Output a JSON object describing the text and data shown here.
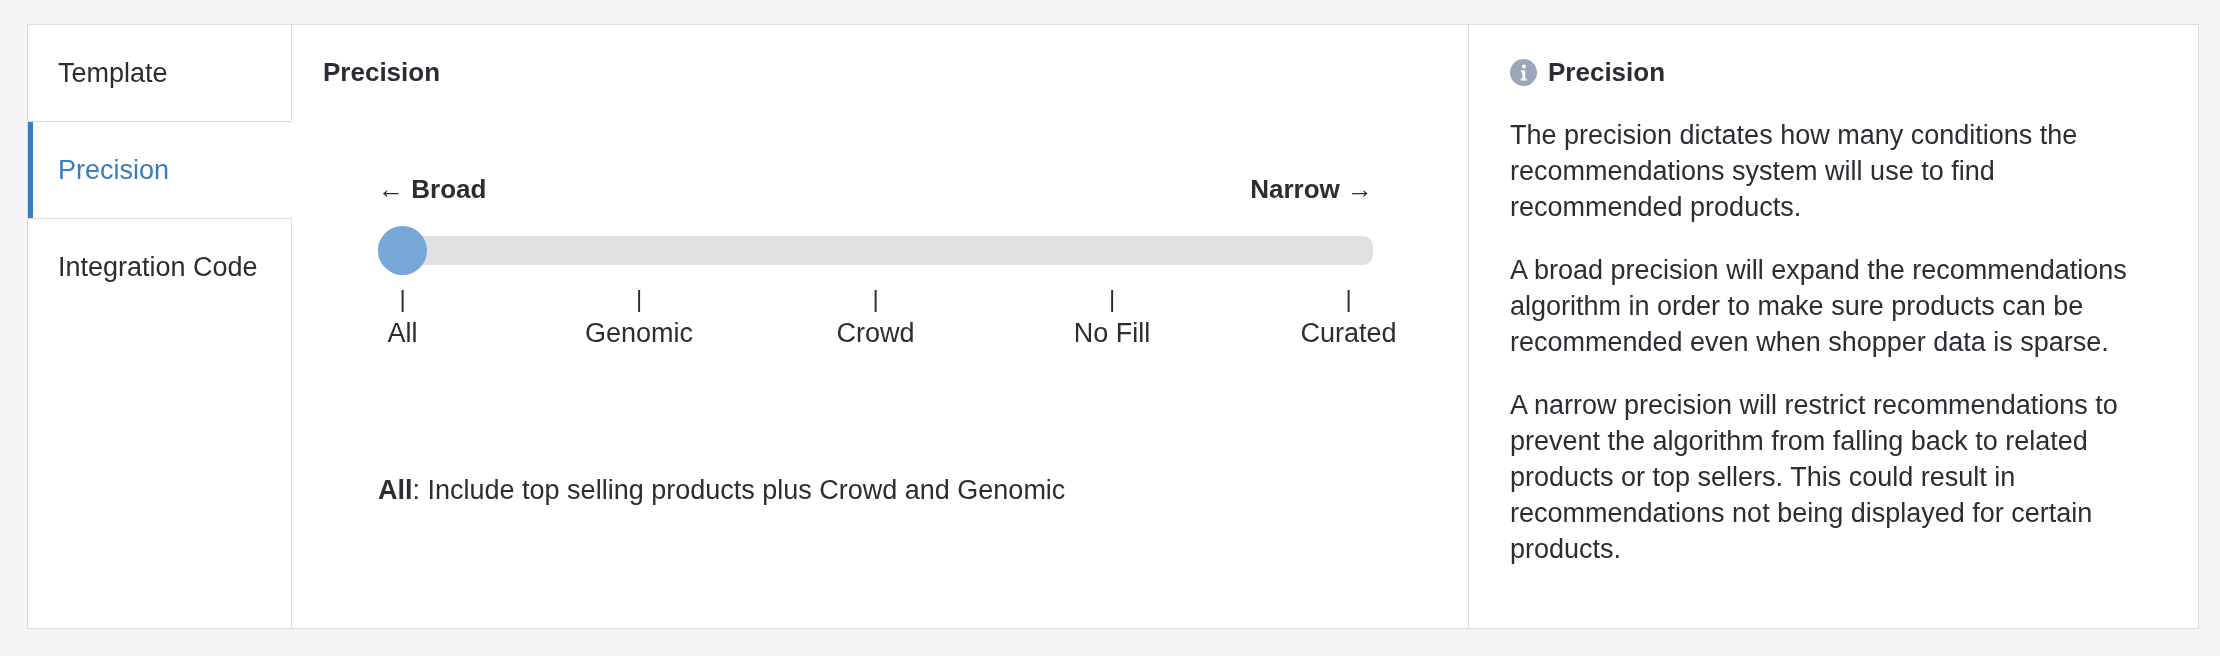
{
  "tabs": [
    {
      "label": "Template",
      "selected": false
    },
    {
      "label": "Precision",
      "selected": true
    },
    {
      "label": "Integration Code",
      "selected": false
    }
  ],
  "main": {
    "title": "Precision",
    "slider": {
      "left_label": "← **Broad**",
      "right_label": "**Narrow** →",
      "level": 0,
      "stops": [
        {
          "tick": "|",
          "label": "All"
        },
        {
          "tick": "|",
          "label": "Genomic"
        },
        {
          "tick": "|",
          "label": "Crowd"
        },
        {
          "tick": "|",
          "label": "No Fill"
        },
        {
          "tick": "|",
          "label": "Curated"
        }
      ]
    },
    "description": "**All**: Include top selling products plus Crowd and Genomic"
  },
  "help": {
    "title": "Precision",
    "paragraphs": [
      "The precision dictates how many conditions the recommendations system will use to find recommended products.",
      "A broad precision will expand the recommendations algorithm in order to make sure products can be recommended even when shopper data is sparse.",
      "A narrow precision will restrict recommendations to prevent the algorithm from falling back to related products or top sellers. This could result in recommendations not being displayed for certain products."
    ]
  }
}
